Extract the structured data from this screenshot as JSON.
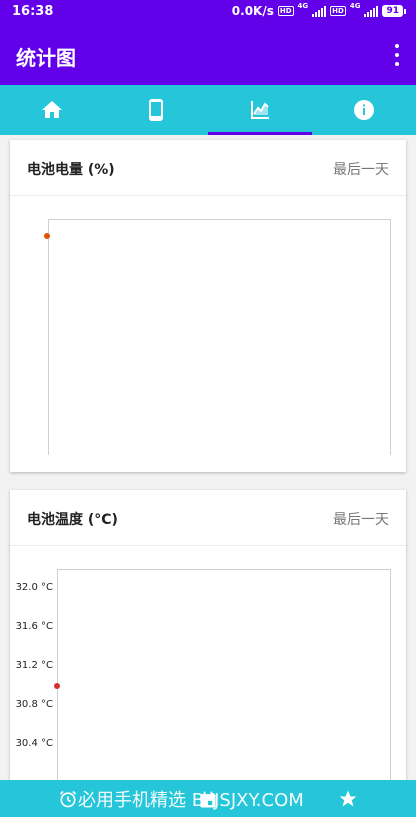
{
  "status_bar": {
    "time": "16:38",
    "net_speed": "0.0K/s",
    "sim1_tag": "HD",
    "sim1_type": "4G",
    "sim2_tag": "HD",
    "sim2_type": "4G",
    "battery": "91"
  },
  "app_bar": {
    "title": "统计图"
  },
  "tabs": [
    {
      "icon": "home-icon",
      "active": false
    },
    {
      "icon": "phone-icon",
      "active": false
    },
    {
      "icon": "chart-icon",
      "active": true
    },
    {
      "icon": "info-icon",
      "active": false
    }
  ],
  "battery_card": {
    "title": "电池电量 (%)",
    "range": "最后一天"
  },
  "temperature_card": {
    "title": "电池温度 (°C)",
    "range": "最后一天",
    "y_ticks": [
      "32.0 °C",
      "31.6 °C",
      "31.2 °C",
      "30.8 °C",
      "30.4 °C"
    ]
  },
  "bottom_bar": {
    "watermark": "必用手机精选 BYJSJXY.COM"
  },
  "colors": {
    "primary": "#6200ea",
    "tab_bg": "#26c6da",
    "battery_point": "#e65100",
    "temp_point": "#d32f2f"
  },
  "chart_data": [
    {
      "type": "scatter",
      "title": "电池电量 (%)",
      "series": [
        {
          "values": [
            null
          ]
        }
      ]
    },
    {
      "type": "scatter",
      "title": "电池温度 (°C)",
      "ylabel": "",
      "y_ticks": [
        32.0,
        31.6,
        31.2,
        30.8,
        30.4
      ],
      "series": [
        {
          "values": [
            31.0
          ]
        }
      ]
    }
  ]
}
